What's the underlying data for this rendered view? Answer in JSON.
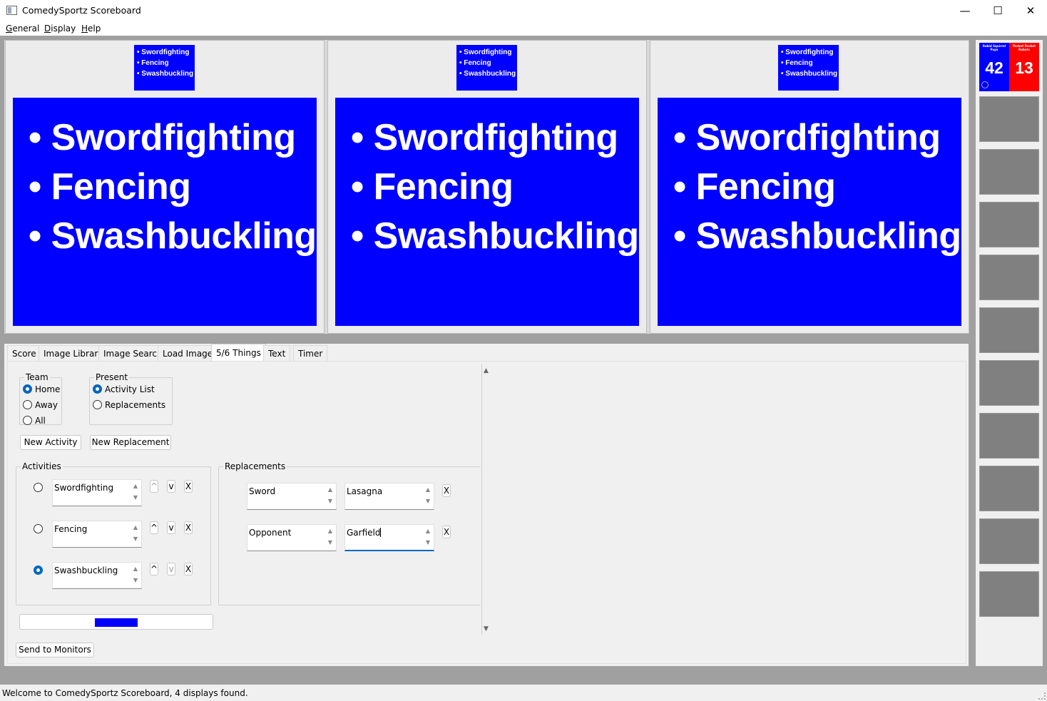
{
  "window": {
    "title": "ComedySportz Scoreboard",
    "minimize": "—",
    "maximize": "☐",
    "close": "✕"
  },
  "menu": [
    {
      "label": "General",
      "accel": "G",
      "rest": "eneral"
    },
    {
      "label": "Display",
      "accel": "D",
      "rest": "isplay"
    },
    {
      "label": "Help",
      "accel": "H",
      "rest": "elp"
    }
  ],
  "slide": {
    "items": [
      "• Swordfighting",
      "• Fencing",
      "• Swashbuckling"
    ],
    "background": "#0000ff"
  },
  "scoreboard": {
    "home_score": "42",
    "away_score": "13",
    "home_name": "Rabid Squirrel Pups",
    "away_name": "Pocket Rocket Robots",
    "home_color": "#0000ff",
    "away_color": "#ff0000"
  },
  "tabs": [
    "Score",
    "Image Library",
    "Image Search",
    "Load Image",
    "5/6 Things",
    "Text",
    "Timer"
  ],
  "active_tab": "5/6 Things",
  "team_group": {
    "title": "Team",
    "options": [
      "Home",
      "Away",
      "All"
    ],
    "selected": "Home"
  },
  "present_group": {
    "title": "Present",
    "options": [
      "Activity List",
      "Replacements"
    ],
    "selected": "Activity List"
  },
  "buttons": {
    "new_activity": "New Activity",
    "new_replacement": "New Replacement",
    "send_to_monitors": "Send to Monitors"
  },
  "activities": {
    "title": "Activities",
    "rows": [
      {
        "text": "Swordfighting",
        "selected": false,
        "up": "^",
        "down": "v",
        "remove": "X"
      },
      {
        "text": "Fencing",
        "selected": false,
        "up": "^",
        "down": "v",
        "remove": "X"
      },
      {
        "text": "Swashbuckling",
        "selected": true,
        "up": "^",
        "down": "v",
        "remove": "X"
      }
    ]
  },
  "replacements": {
    "title": "Replacements",
    "rows": [
      {
        "from": "Sword",
        "to": "Lasagna",
        "remove": "X"
      },
      {
        "from": "Opponent",
        "to": "Garfield",
        "remove": "X"
      }
    ]
  },
  "status": "Welcome to ComedySportz Scoreboard, 4 displays found."
}
